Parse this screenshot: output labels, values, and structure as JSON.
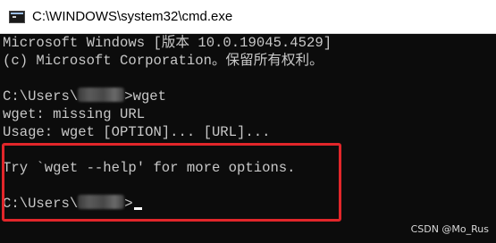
{
  "window": {
    "title": "C:\\WINDOWS\\system32\\cmd.exe",
    "app_icon": "cmd-console-icon"
  },
  "console": {
    "line1": "Microsoft Windows [版本 10.0.19045.4529]",
    "line2": "(c) Microsoft Corporation。保留所有权利。",
    "prompt1_prefix": "C:\\Users\\",
    "prompt1_command": ">wget",
    "output1": "wget: missing URL",
    "output2": "Usage: wget [OPTION]... [URL]...",
    "output3": "Try `wget --help' for more options.",
    "prompt2_prefix": "C:\\Users\\",
    "prompt2_suffix": ">"
  },
  "annotation": {
    "highlight_color": "#e2262a"
  },
  "watermark": {
    "text": "CSDN @Mo_Rus"
  },
  "colors": {
    "console_bg": "#0c0c0c",
    "console_fg": "#cccccc",
    "titlebar_bg": "#ffffff"
  }
}
